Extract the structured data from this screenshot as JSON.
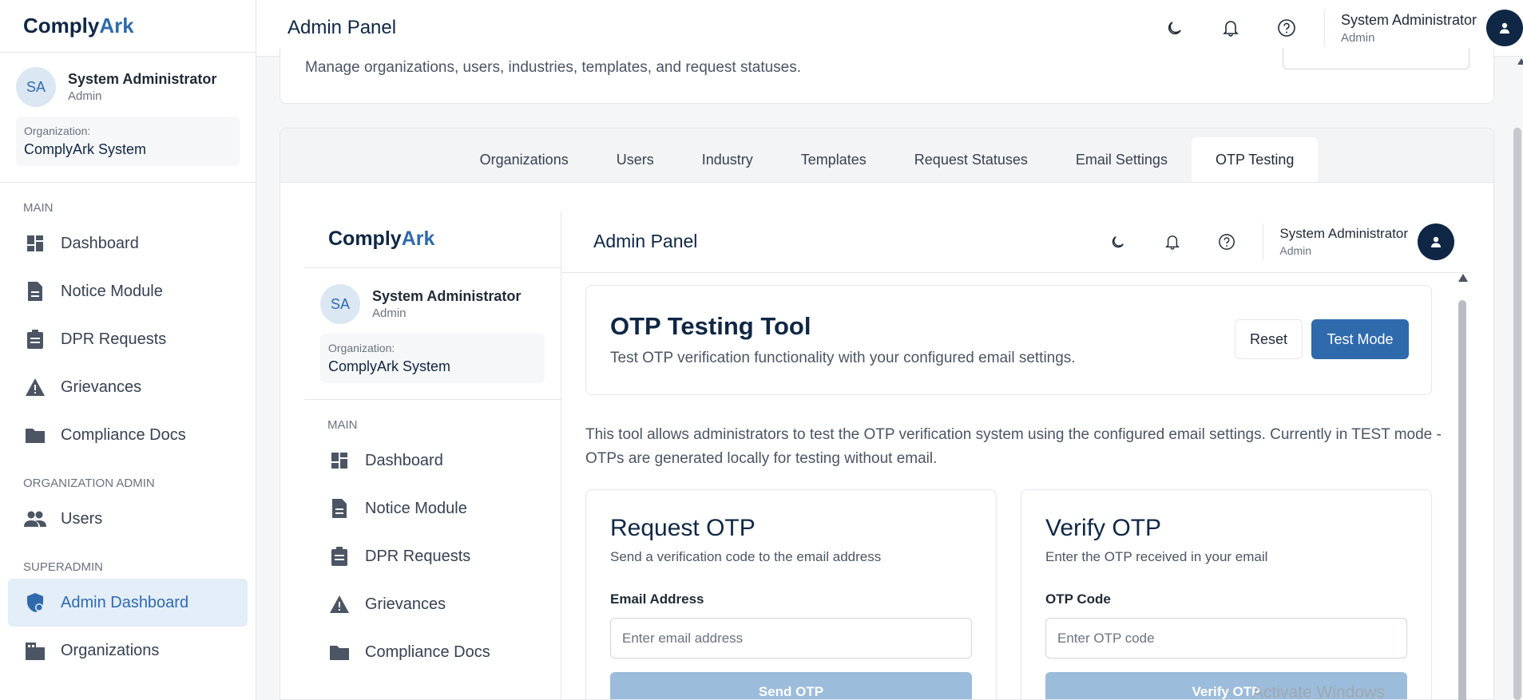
{
  "brand": {
    "prefix": "Comply",
    "suffix": "Ark"
  },
  "user": {
    "initials": "SA",
    "name": "System Administrator",
    "role": "Admin",
    "org_label": "Organization:",
    "org_name": "ComplyArk System"
  },
  "sidebar": {
    "main_label": "MAIN",
    "main_items": [
      {
        "label": "Dashboard",
        "icon": "dashboard-icon"
      },
      {
        "label": "Notice Module",
        "icon": "document-icon"
      },
      {
        "label": "DPR Requests",
        "icon": "clipboard-icon"
      },
      {
        "label": "Grievances",
        "icon": "warning-icon"
      },
      {
        "label": "Compliance Docs",
        "icon": "folder-icon"
      }
    ],
    "org_admin_label": "ORGANIZATION ADMIN",
    "org_admin_items": [
      {
        "label": "Users",
        "icon": "users-icon"
      }
    ],
    "superadmin_label": "SUPERADMIN",
    "superadmin_items": [
      {
        "label": "Admin Dashboard",
        "icon": "shield-icon",
        "active": true
      },
      {
        "label": "Organizations",
        "icon": "building-icon"
      }
    ]
  },
  "header": {
    "title": "Admin Panel",
    "icons": [
      "moon-icon",
      "bell-icon",
      "help-icon"
    ]
  },
  "page": {
    "subtitle": "Manage organizations, users, industries, templates, and request statuses."
  },
  "tabs": [
    {
      "label": "Organizations"
    },
    {
      "label": "Users"
    },
    {
      "label": "Industry"
    },
    {
      "label": "Templates"
    },
    {
      "label": "Request Statuses"
    },
    {
      "label": "Email Settings"
    },
    {
      "label": "OTP Testing",
      "active": true
    }
  ],
  "otp": {
    "title": "OTP Testing Tool",
    "subtitle": "Test OTP verification functionality with your configured email settings.",
    "reset_label": "Reset",
    "mode_label": "Test Mode",
    "description": "This tool allows administrators to test the OTP verification system using the configured email settings. Currently in TEST mode - OTPs are generated locally for testing without email.",
    "request": {
      "title": "Request OTP",
      "subtitle": "Send a verification code to the email address",
      "field_label": "Email Address",
      "placeholder": "Enter email address",
      "button": "Send OTP"
    },
    "verify": {
      "title": "Verify OTP",
      "subtitle": "Enter the OTP received in your email",
      "field_label": "OTP Code",
      "placeholder": "Enter OTP code",
      "button": "Verify OTP"
    }
  },
  "watermark": "Activate Windows",
  "colors": {
    "navy": "#0f2744",
    "accent": "#2f6aad",
    "active_bg": "#e3eef8",
    "disabled_btn": "#9cbcdb"
  }
}
